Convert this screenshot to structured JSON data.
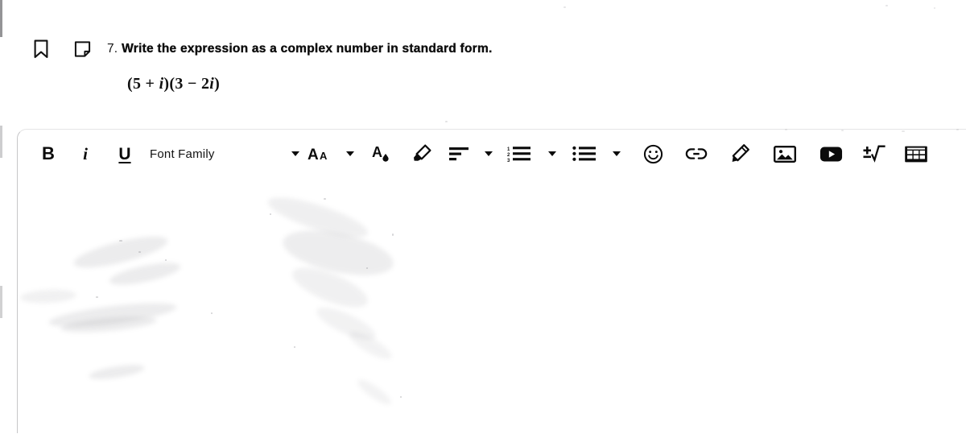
{
  "question": {
    "bookmark_icon": "bookmark-icon",
    "note_icon": "note-icon",
    "number": "7.",
    "prompt": "Write the expression as a complex number in standard form.",
    "expression_prefix": "(5 + ",
    "expression_i1": "i",
    "expression_mid": ")(3 − 2",
    "expression_i2": "i",
    "expression_suffix": ")",
    "expression_plain": "(5 + i)(3 − 2i)"
  },
  "editor": {
    "toolbar": {
      "bold_label": "B",
      "italic_label": "i",
      "underline_label": "U",
      "font_family_label": "Font Family",
      "font_size_label": "AA",
      "items": [
        {
          "name": "bold-button",
          "type": "text",
          "label": "B",
          "title": "Bold"
        },
        {
          "name": "italic-button",
          "type": "text",
          "label": "i",
          "title": "Italic"
        },
        {
          "name": "underline-button",
          "type": "text",
          "label": "U",
          "title": "Underline"
        },
        {
          "name": "font-family-select",
          "type": "text",
          "label": "Font Family",
          "title": "Font Family"
        },
        {
          "name": "font-family-caret-icon",
          "type": "caret",
          "label": "",
          "title": "Font Family dropdown"
        },
        {
          "name": "font-size-button",
          "type": "text",
          "label": "AA",
          "title": "Font Size"
        },
        {
          "name": "font-size-caret-icon",
          "type": "caret",
          "label": "",
          "title": "Font Size dropdown"
        },
        {
          "name": "text-color-icon",
          "type": "icon",
          "label": "",
          "title": "Text Color"
        },
        {
          "name": "highlighter-icon",
          "type": "icon",
          "label": "",
          "title": "Highlight"
        },
        {
          "name": "align-left-icon",
          "type": "icon",
          "label": "",
          "title": "Align"
        },
        {
          "name": "align-caret-icon",
          "type": "caret",
          "label": "",
          "title": "Alignment dropdown"
        },
        {
          "name": "numbered-list-icon",
          "type": "icon",
          "label": "",
          "title": "Numbered List"
        },
        {
          "name": "numbered-list-caret-icon",
          "type": "caret",
          "label": "",
          "title": "Numbered List dropdown"
        },
        {
          "name": "bullet-list-icon",
          "type": "icon",
          "label": "",
          "title": "Bulleted List"
        },
        {
          "name": "bullet-list-caret-icon",
          "type": "caret",
          "label": "",
          "title": "Bulleted List dropdown"
        },
        {
          "name": "emoji-icon",
          "type": "icon",
          "label": "",
          "title": "Insert Emoji"
        },
        {
          "name": "link-icon",
          "type": "icon",
          "label": "",
          "title": "Insert Link"
        },
        {
          "name": "draw-icon",
          "type": "icon",
          "label": "",
          "title": "Draw"
        },
        {
          "name": "image-icon",
          "type": "icon",
          "label": "",
          "title": "Insert Image"
        },
        {
          "name": "video-icon",
          "type": "icon",
          "label": "",
          "title": "Insert Video"
        },
        {
          "name": "math-equation-icon",
          "type": "icon",
          "label": "",
          "title": "Insert Equation"
        },
        {
          "name": "table-icon",
          "type": "icon",
          "label": "",
          "title": "Insert Table"
        }
      ]
    },
    "body_text": ""
  },
  "colors": {
    "ink": "#0b0b0b",
    "border": "#c6c6c8",
    "page_background": "#ffffff"
  }
}
